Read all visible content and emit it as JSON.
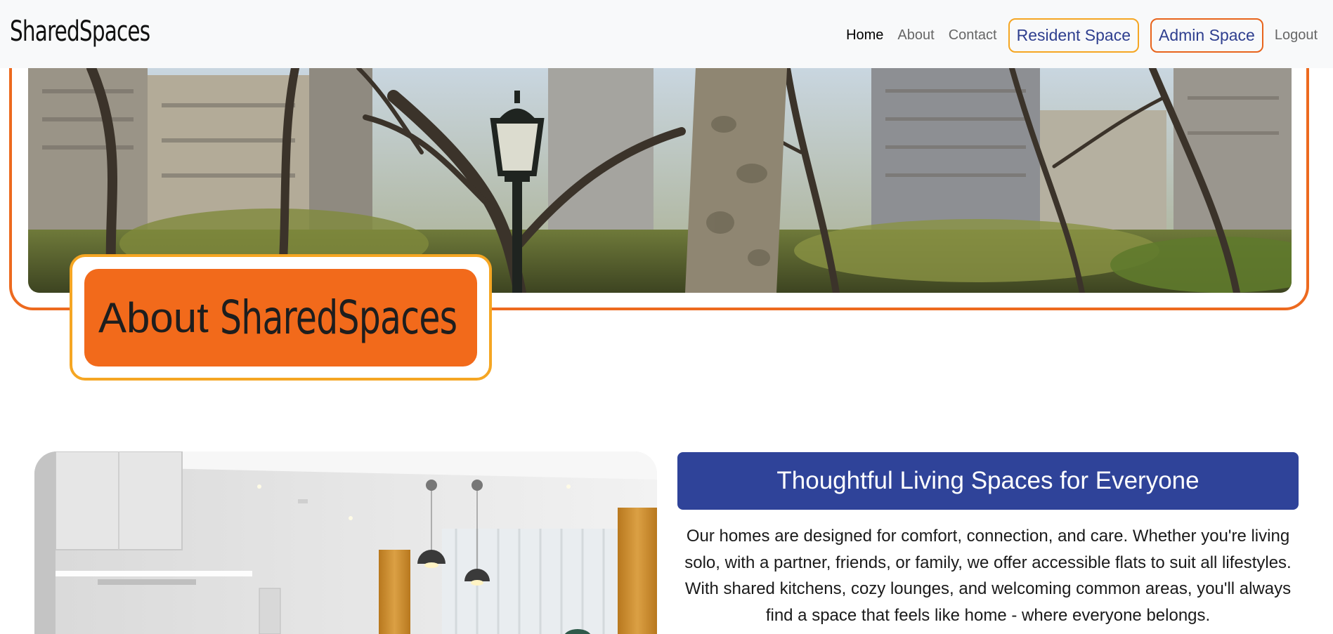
{
  "navbar": {
    "brand": "SharedSpaces",
    "links": {
      "home": "Home",
      "about": "About",
      "contact": "Contact",
      "resident": "Resident Space",
      "admin": "Admin Space",
      "logout": "Logout"
    },
    "active": "Home"
  },
  "hero": {
    "heading_word": "About",
    "heading_brand": "SharedSpaces"
  },
  "section": {
    "title": "Thoughtful Living Spaces for Everyone",
    "body": "Our homes are designed for comfort, connection, and care. Whether you're living solo, with a partner, friends, or family, we offer accessible flats to suit all lifestyles. With shared kitchens, cozy lounges, and welcoming common areas, you'll always find a space that feels like home - where everyone belongs."
  },
  "colors": {
    "navbar_bg": "#f8f9fa",
    "accent_orange": "#ed6a1f",
    "accent_amber": "#f5a623",
    "brand_blue": "#2f4399"
  }
}
